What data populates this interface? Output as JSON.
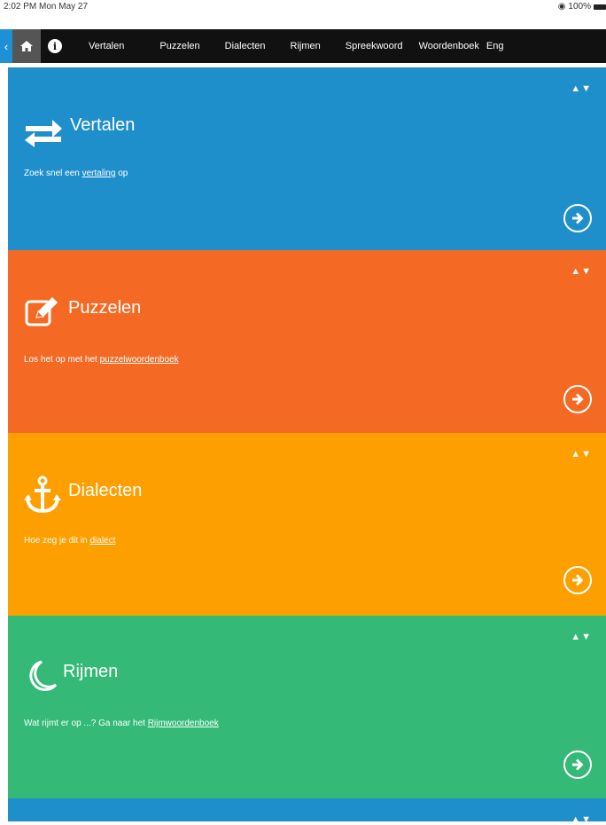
{
  "status": {
    "time": "2:02 PM  Mon May 27",
    "battery": "100%"
  },
  "nav": {
    "back_icon": "chevron-left-icon",
    "home_icon": "home-icon",
    "info_icon": "info-icon",
    "items": [
      "Vertalen",
      "Puzzelen",
      "Dialecten",
      "Rijmen",
      "Spreekwoord",
      "Woordenboek",
      "Eng"
    ]
  },
  "panels": [
    {
      "title": "Vertalen",
      "desc_prefix": "Zoek snel een ",
      "link": "vertaling",
      "desc_suffix": " op",
      "color": "#1f8fcb",
      "icon": "swap-arrows-icon"
    },
    {
      "title": "Puzzelen",
      "desc_prefix": "Los het op met het ",
      "link": "puzzelwoordenboek",
      "desc_suffix": "",
      "color": "#f46a25",
      "icon": "edit-icon"
    },
    {
      "title": "Dialecten",
      "desc_prefix": "Hoe zeg je dit in ",
      "link": "dialect",
      "desc_suffix": "",
      "color": "#fe9f00",
      "icon": "anchor-icon"
    },
    {
      "title": "Rijmen",
      "desc_prefix": "Wat rijmt er op ...? Ga naar het ",
      "link": "Rijmwoordenboek",
      "desc_suffix": "",
      "color": "#34b976",
      "icon": "moon-icon"
    }
  ],
  "sort_arrows": "▲▼"
}
